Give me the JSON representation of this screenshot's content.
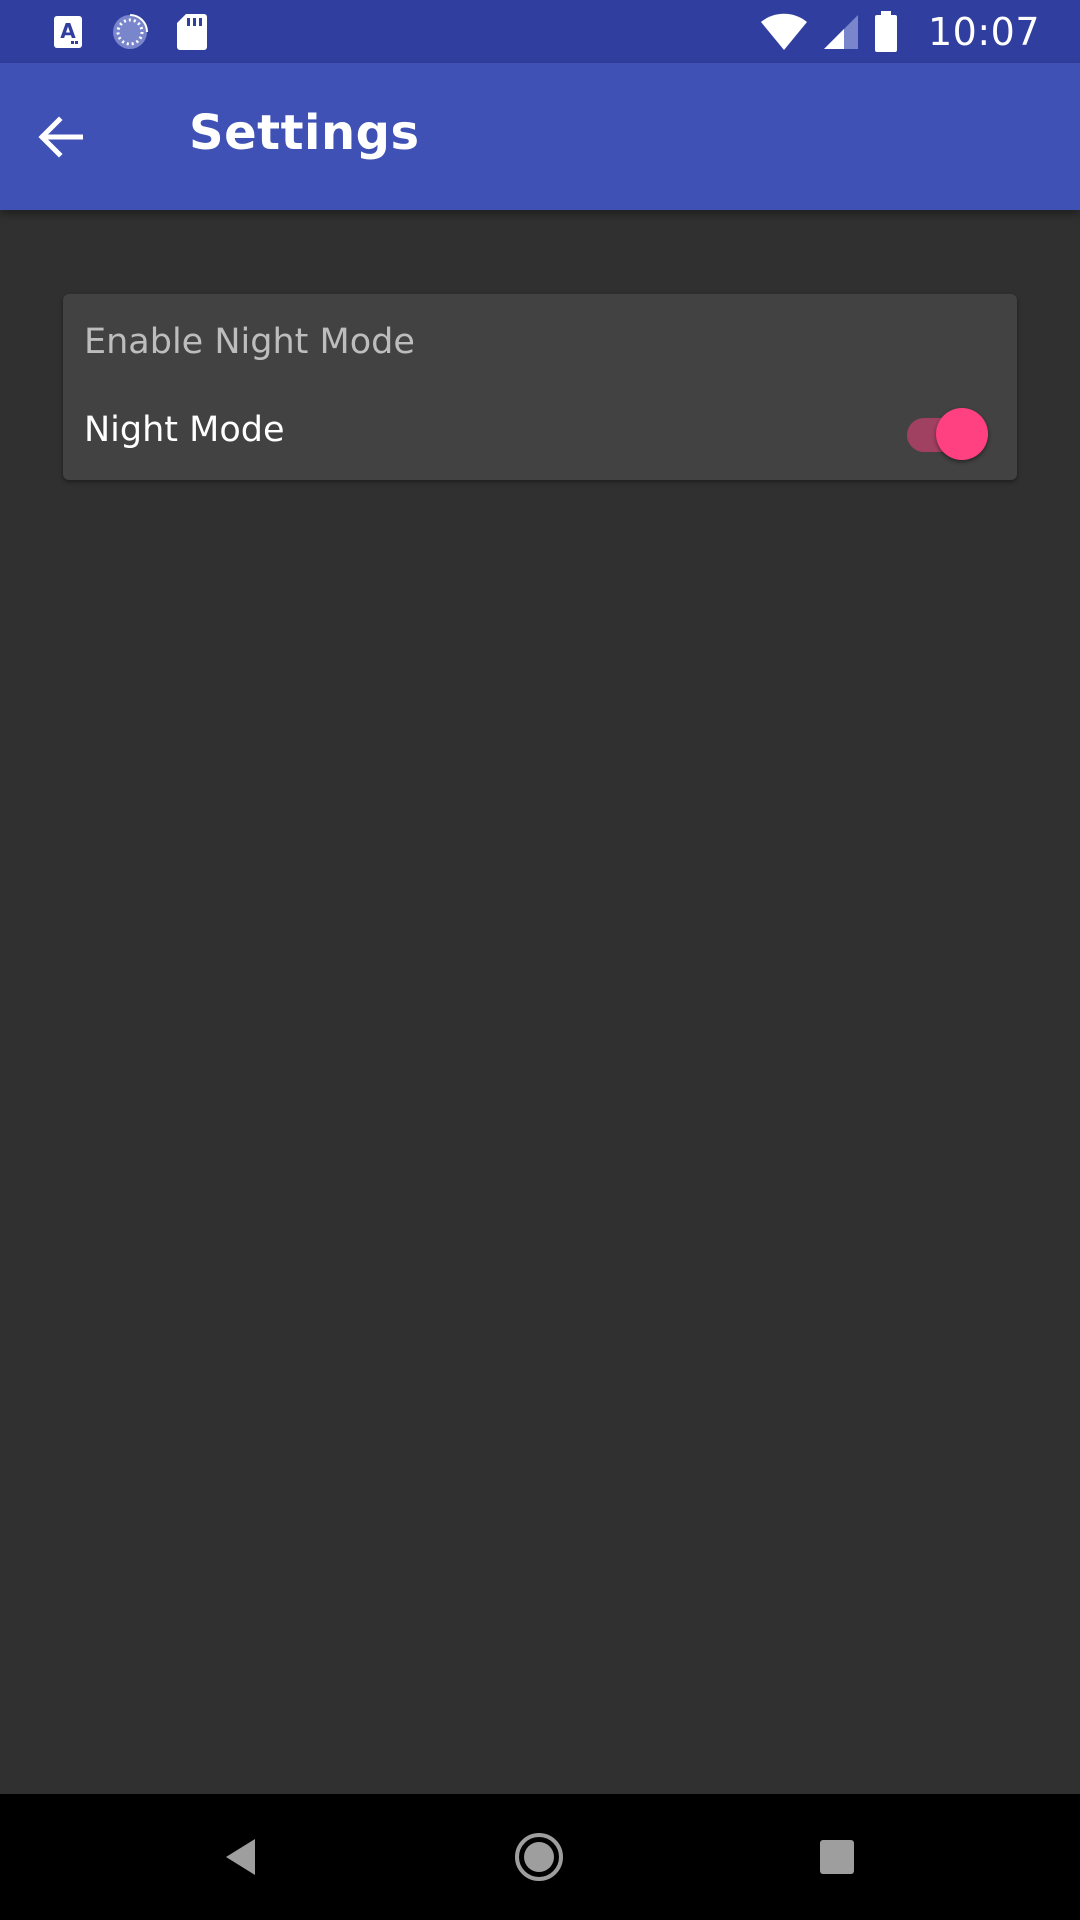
{
  "status_bar": {
    "time": "10:07",
    "left_icons": [
      "text-a-icon",
      "sync-progress-icon",
      "sd-card-icon"
    ],
    "right_icons": [
      "wifi-icon",
      "cell-signal-icon",
      "battery-icon"
    ],
    "background_color": "#303F9F"
  },
  "app_bar": {
    "title": "Settings",
    "back_icon": "arrow-back-icon",
    "background_color": "#3F51B5"
  },
  "preferences": {
    "category_title": "Enable Night Mode",
    "items": [
      {
        "label": "Night Mode",
        "type": "switch",
        "checked": true
      }
    ]
  },
  "colors": {
    "accent": "#FF4081",
    "content_background": "#303030",
    "card_background": "#424242",
    "category_text": "#BDBDBD",
    "primary_text": "#FFFFFF"
  },
  "nav_bar": {
    "buttons": [
      "nav-back-icon",
      "nav-home-icon",
      "nav-recents-icon"
    ]
  }
}
